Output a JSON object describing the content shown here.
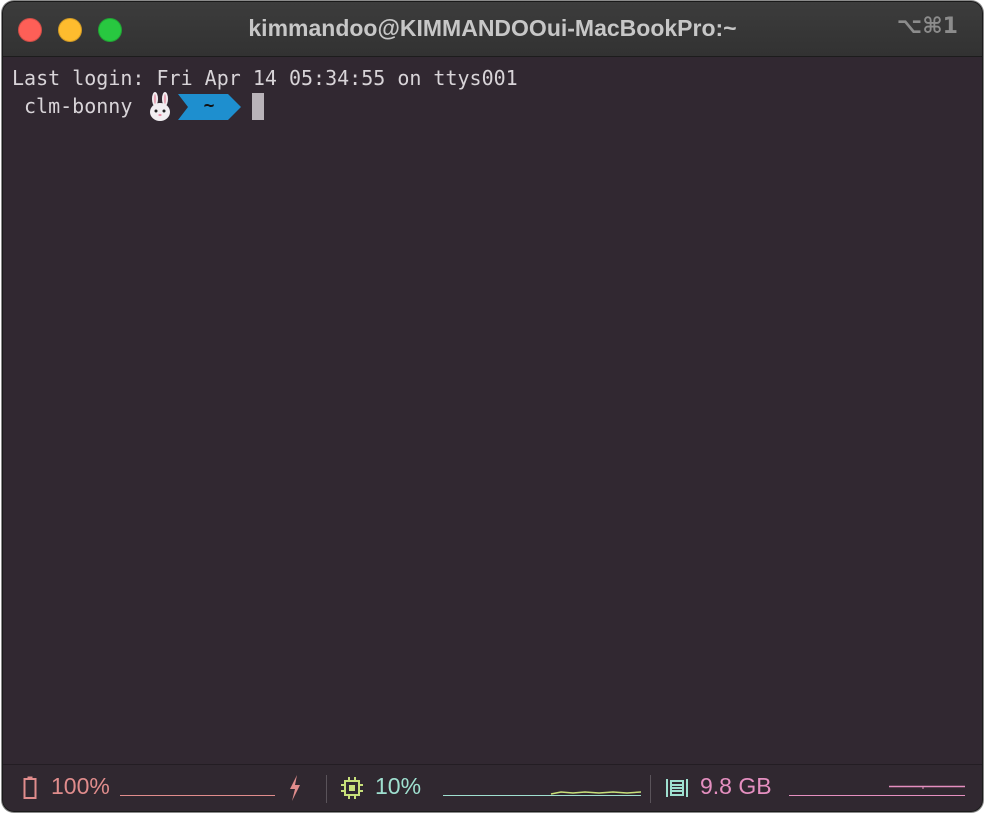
{
  "window": {
    "title": "kimmandoo@KIMMANDOOui-MacBookPro:~",
    "shortcut": "⌥⌘1",
    "background": "#312831"
  },
  "terminal": {
    "last_login": "Last login: Fri Apr 14 05:34:55 on ttys001",
    "prompt_user": "clm-bonny",
    "prompt_icon": "rabbit-icon",
    "prompt_dir": "~",
    "prompt_dir_color": "#1e8fcf"
  },
  "statusbar": {
    "battery": {
      "icon": "battery-icon",
      "value": "100%",
      "color": "#e08c8c"
    },
    "charging_icon": "lightning-icon",
    "cpu": {
      "icon": "cpu-chip-icon",
      "value": "10%",
      "color": "#9fe0d0"
    },
    "memory": {
      "icon": "memory-icon",
      "value": "9.8 GB",
      "color": "#e58fc0"
    }
  }
}
